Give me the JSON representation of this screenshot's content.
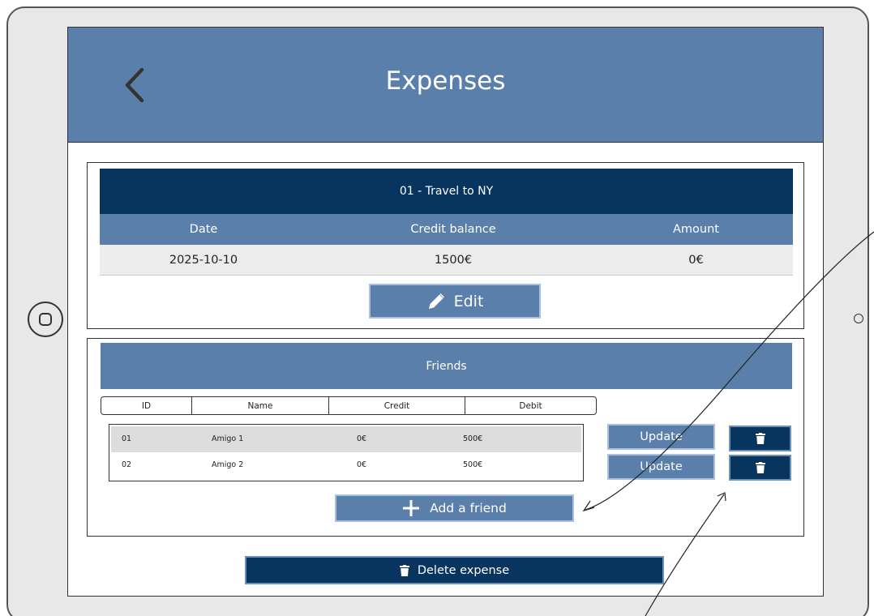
{
  "header": {
    "title": "Expenses",
    "back_icon": "chevron-left-icon"
  },
  "expense": {
    "title": "01 - Travel to NY",
    "columns": [
      "Date",
      "Credit balance",
      "Amount"
    ],
    "values": [
      "2025-10-10",
      "1500€",
      "0€"
    ],
    "edit_label": "Edit",
    "edit_icon": "pencil-icon"
  },
  "friends": {
    "title": "Friends",
    "columns": [
      "ID",
      "Name",
      "Credit",
      "Debit"
    ],
    "rows": [
      {
        "id": "01",
        "name": "Amigo 1",
        "credit": "0€",
        "debit": "500€"
      },
      {
        "id": "02",
        "name": "Amigo 2",
        "credit": "0€",
        "debit": "500€"
      }
    ],
    "update_label": "Update",
    "delete_icon": "trash-icon",
    "add_label": "Add a friend",
    "add_icon": "plus-icon"
  },
  "footer": {
    "delete_expense_label": "Delete expense",
    "delete_icon": "trash-icon"
  },
  "colors": {
    "primary": "#5b7fab",
    "dark": "#083460",
    "row_alt": "#ececec"
  }
}
